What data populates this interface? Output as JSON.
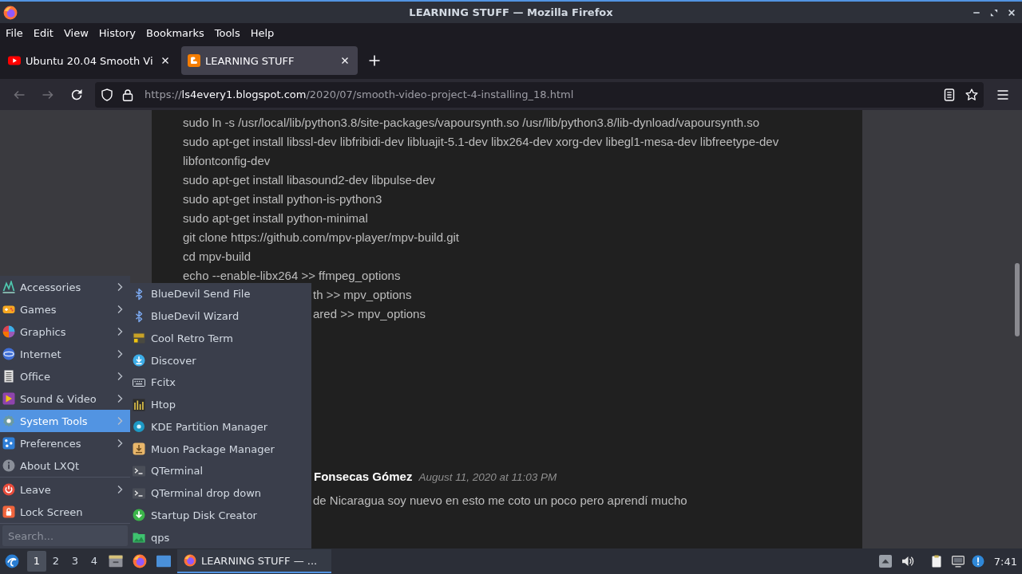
{
  "window": {
    "title": "LEARNING STUFF — Mozilla Firefox"
  },
  "menu_bar": [
    "File",
    "Edit",
    "View",
    "History",
    "Bookmarks",
    "Tools",
    "Help"
  ],
  "tabs": [
    {
      "title": "Ubuntu 20.04 Smooth Vi",
      "selected": false
    },
    {
      "title": "LEARNING STUFF",
      "selected": true
    }
  ],
  "navigation": {
    "back": {
      "disabled": true
    },
    "forward": {
      "disabled": true
    }
  },
  "address": {
    "scheme": "https://",
    "host": "ls4every1.blogspot.com",
    "path": "/2020/07/smooth-video-project-4-installing_18.html"
  },
  "page": {
    "lines": [
      "sudo ln -s /usr/local/lib/python3.8/site-packages/vapoursynth.so /usr/lib/python3.8/lib-dynload/vapoursynth.so",
      "sudo apt-get install libssl-dev libfribidi-dev libluajit-5.1-dev libx264-dev xorg-dev libegl1-mesa-dev libfreetype-dev",
      "libfontconfig-dev",
      "sudo apt-get install libasound2-dev libpulse-dev",
      "sudo apt-get install python-is-python3",
      "sudo apt-get install python-minimal",
      "git clone https://github.com/mpv-player/mpv-build.git",
      "cd mpv-build",
      "echo --enable-libx264 >> ffmpeg_options"
    ],
    "partly_hidden_lines": [
      "th >> mpv_options",
      "ared >> mpv_options"
    ],
    "comment": {
      "author": "Fonsecas Gómez",
      "date": "August 11, 2020 at 11:03 PM",
      "text": "de Nicaragua soy nuevo en esto me coto un poco pero aprendí mucho"
    }
  },
  "start_menu": {
    "items": [
      {
        "kind": "submenu",
        "label": "Accessories",
        "selected": false
      },
      {
        "kind": "submenu",
        "label": "Games",
        "selected": false
      },
      {
        "kind": "submenu",
        "label": "Graphics",
        "selected": false
      },
      {
        "kind": "submenu",
        "label": "Internet",
        "selected": false
      },
      {
        "kind": "submenu",
        "label": "Office",
        "selected": false
      },
      {
        "kind": "submenu",
        "label": "Sound & Video",
        "selected": false
      },
      {
        "kind": "submenu",
        "label": "System Tools",
        "selected": true
      },
      {
        "kind": "submenu",
        "label": "Preferences",
        "selected": false
      },
      {
        "kind": "action",
        "label": "About LXQt",
        "selected": false
      },
      {
        "kind": "separator"
      },
      {
        "kind": "submenu",
        "label": "Leave",
        "selected": false
      },
      {
        "kind": "action",
        "label": "Lock Screen",
        "selected": false
      }
    ],
    "search": {
      "placeholder": "Search..."
    }
  },
  "submenu": {
    "items": [
      "BlueDevil Send File",
      "BlueDevil Wizard",
      "Cool Retro Term",
      "Discover",
      "Fcitx",
      "Htop",
      "KDE Partition Manager",
      "Muon Package Manager",
      "QTerminal",
      "QTerminal drop down",
      "Startup Disk Creator",
      "qps"
    ]
  },
  "taskbar": {
    "workspaces": [
      {
        "label": "1",
        "selected": true
      },
      {
        "label": "2",
        "selected": false
      },
      {
        "label": "3",
        "selected": false
      },
      {
        "label": "4",
        "selected": false
      }
    ],
    "tasks": [
      {
        "label": "LEARNING STUFF — ...",
        "active": true
      }
    ],
    "clock": "7:41"
  }
}
